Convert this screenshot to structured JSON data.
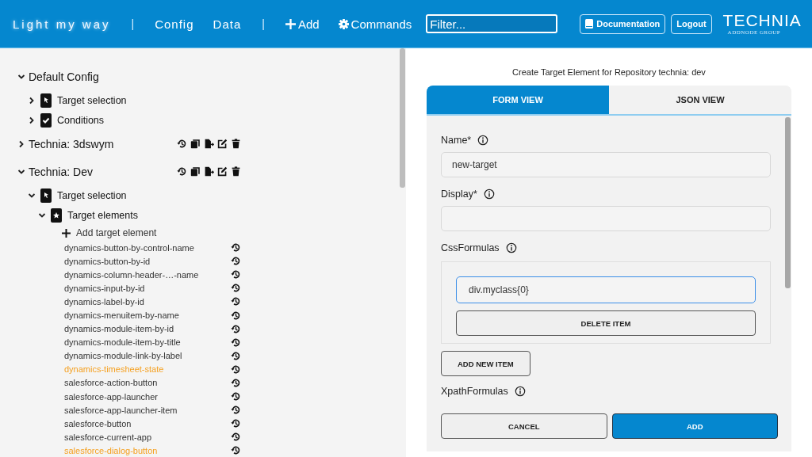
{
  "header": {
    "app_title": "Light my way",
    "separator_1": "|",
    "nav": [
      {
        "label": "Config"
      },
      {
        "label": "Data"
      }
    ],
    "separator_2": "|",
    "add_label": "Add",
    "commands_label": "Commands",
    "filter": {
      "placeholder": "Filter..."
    },
    "documentation_label": "Documentation",
    "logout_label": "Logout",
    "logo": {
      "name": "TECHNIA",
      "tagline": "ADDNODE GROUP"
    }
  },
  "tree": [
    {
      "kind": "group",
      "label": "Default Config",
      "expanded": true,
      "actions": false,
      "children": [
        {
          "kind": "selection",
          "label": "Target selection",
          "expanded": false
        },
        {
          "kind": "conditions",
          "label": "Conditions",
          "expanded": false
        }
      ]
    },
    {
      "kind": "group",
      "label": "Technia: 3dswym",
      "expanded": false,
      "actions": true
    },
    {
      "kind": "group",
      "label": "Technia: Dev",
      "expanded": true,
      "actions": true,
      "children": [
        {
          "kind": "selection",
          "label": "Target selection",
          "expanded": true,
          "children": [
            {
              "kind": "elements",
              "label": "Target elements",
              "expanded": true,
              "children": [
                {
                  "kind": "add",
                  "label": "Add target element"
                },
                {
                  "kind": "element",
                  "label": "dynamics-button-by-control-name",
                  "modified": false
                },
                {
                  "kind": "element",
                  "label": "dynamics-button-by-id",
                  "modified": false
                },
                {
                  "kind": "element",
                  "label": "dynamics-column-header-…-name",
                  "modified": false
                },
                {
                  "kind": "element",
                  "label": "dynamics-input-by-id",
                  "modified": false
                },
                {
                  "kind": "element",
                  "label": "dynamics-label-by-id",
                  "modified": false
                },
                {
                  "kind": "element",
                  "label": "dynamics-menuitem-by-name",
                  "modified": false
                },
                {
                  "kind": "element",
                  "label": "dynamics-module-item-by-id",
                  "modified": false
                },
                {
                  "kind": "element",
                  "label": "dynamics-module-item-by-title",
                  "modified": false
                },
                {
                  "kind": "element",
                  "label": "dynamics-module-link-by-label",
                  "modified": false
                },
                {
                  "kind": "element",
                  "label": "dynamics-timesheet-state",
                  "modified": true
                },
                {
                  "kind": "element",
                  "label": "salesforce-action-button",
                  "modified": false
                },
                {
                  "kind": "element",
                  "label": "salesforce-app-launcher",
                  "modified": false
                },
                {
                  "kind": "element",
                  "label": "salesforce-app-launcher-item",
                  "modified": false
                },
                {
                  "kind": "element",
                  "label": "salesforce-button",
                  "modified": false
                },
                {
                  "kind": "element",
                  "label": "salesforce-current-app",
                  "modified": false
                },
                {
                  "kind": "element",
                  "label": "salesforce-dialog-button",
                  "modified": true
                }
              ]
            }
          ]
        }
      ]
    }
  ],
  "form": {
    "title": "Create Target Element for Repository technia: dev",
    "tabs": [
      {
        "label": "FORM VIEW",
        "selected": true
      },
      {
        "label": "JSON VIEW",
        "selected": false
      }
    ],
    "fields": [
      {
        "kind": "text",
        "label": "Name*",
        "value": "new-target"
      },
      {
        "kind": "text",
        "label": "Display*"
      },
      {
        "kind": "array",
        "label": "CssFormulas",
        "items": [
          {
            "value": "div.myclass{0}",
            "focused": true,
            "delete_label": "DELETE ITEM"
          }
        ],
        "add_label": "ADD NEW ITEM"
      },
      {
        "kind": "array",
        "label": "XpathFormulas"
      }
    ],
    "buttons": [
      {
        "kind": "secondary",
        "label": "CANCEL"
      },
      {
        "kind": "primary",
        "label": "ADD"
      }
    ]
  }
}
